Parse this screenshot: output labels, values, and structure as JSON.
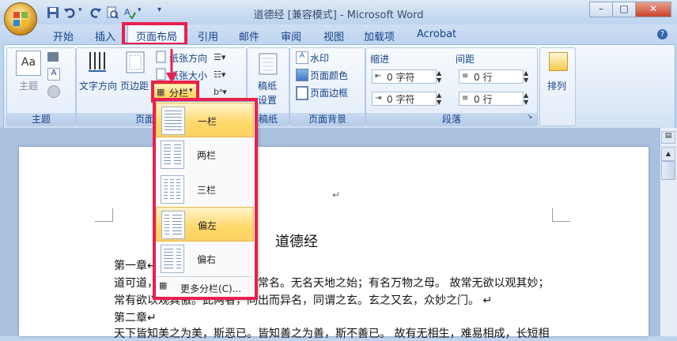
{
  "window": {
    "title": "道德经 [兼容模式] - Microsoft Word",
    "min": "–",
    "max": "□",
    "close": "✕"
  },
  "tabs": [
    "开始",
    "插入",
    "页面布局",
    "引用",
    "邮件",
    "审阅",
    "视图",
    "加载项",
    "Acrobat"
  ],
  "active_tab": "页面布局",
  "ribbon": {
    "theme_group": {
      "label": "主题",
      "theme_btn": "主题"
    },
    "page_setup": {
      "label": "页面设置",
      "text_dir": "文字方向",
      "margins": "页边距",
      "orientation": "纸张方向",
      "size": "纸张大小",
      "columns": "分栏"
    },
    "manuscript": {
      "label": "稿纸",
      "btn_line1": "稿纸",
      "btn_line2": "设置"
    },
    "page_bg": {
      "label": "页面背景",
      "watermark": "水印",
      "page_color": "页面颜色",
      "page_border": "页面边框"
    },
    "paragraph": {
      "label": "段落",
      "indent": "缩进",
      "spacing": "间距",
      "indent_left": "0 字符",
      "indent_right": "0 字符",
      "space_before": "0 行",
      "space_after": "0 行"
    },
    "arrange": {
      "label": "排列"
    }
  },
  "columns_menu": {
    "items": [
      {
        "label": "一栏"
      },
      {
        "label": "两栏"
      },
      {
        "label": "三栏"
      },
      {
        "label": "偏左"
      },
      {
        "label": "偏右"
      }
    ],
    "more": "更多分栏(C)..."
  },
  "document": {
    "title": "道德经",
    "para_mark": "↵",
    "lines": [
      "第一章↵",
      "道可道，非常道。名可名，非常名。无名天地之始；有名万物之母。 故常无欲以观其妙；",
      "常有欲以观其徼。此两者，同出而异名，同谓之玄。玄之又玄，众妙之门。 ↵",
      "第二章↵",
      "天下皆知美之为美，斯恶已。皆知善之为善，斯不善已。 故有无相生，难易相成，长短相"
    ]
  }
}
